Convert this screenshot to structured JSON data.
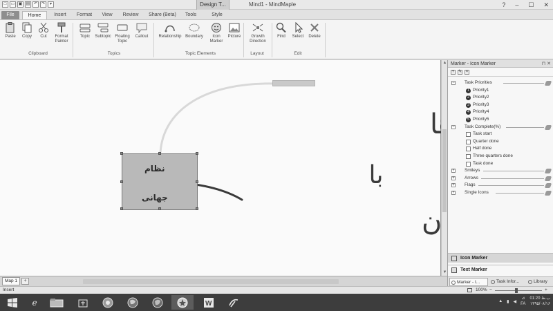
{
  "titlebar": {
    "context_tab": "Design T...",
    "title": "Mind1 - MindMaple",
    "help": "?",
    "minimize": "–",
    "maximize": "☐",
    "close": "✕"
  },
  "tabs": [
    "File",
    "Home",
    "Insert",
    "Format",
    "View",
    "Review",
    "Share (Beta)",
    "Tools",
    "Style"
  ],
  "ribbon": {
    "clipboard": {
      "paste": "Paste",
      "copy": "Copy",
      "cut": "Cut",
      "format_painter": "Format Painter",
      "label": "Clipboard"
    },
    "topics": {
      "topic": "Topic",
      "subtopic": "Subtopic",
      "floating_topic": "Floating Topic",
      "callout": "Callout",
      "label": "Topics"
    },
    "elements": {
      "relationship": "Relationship",
      "boundary": "Boundary",
      "icon_marker": "Icon Marker",
      "picture": "Picture",
      "label": "Topic Elements"
    },
    "layout": {
      "growth": "Growth Direction",
      "label": "Layout"
    },
    "edit": {
      "find": "Find",
      "select": "Select",
      "delete": "Delete",
      "label": "Edit"
    }
  },
  "canvas": {
    "topic_line1": "نظام",
    "topic_line2": "جهانی",
    "handwriting": {
      "line1": "رسم ارتباط ها",
      "line2": "با",
      "line3": "کشیدن از مرکز عنوان"
    }
  },
  "map_tab": "Map 1",
  "panel": {
    "title": "Marker - Icon Marker",
    "pin": "⊓",
    "close": "✕",
    "tree": [
      {
        "type": "group",
        "label": "Task Priorities",
        "expanded": true
      },
      {
        "type": "priority",
        "label": "Priority1",
        "num": "1"
      },
      {
        "type": "priority",
        "label": "Priority2",
        "num": "2"
      },
      {
        "type": "priority",
        "label": "Priority3",
        "num": "3"
      },
      {
        "type": "priority",
        "label": "Priority4",
        "num": "4"
      },
      {
        "type": "priority",
        "label": "Priority5",
        "num": "5"
      },
      {
        "type": "group",
        "label": "Task Complete(%)",
        "expanded": true
      },
      {
        "type": "task",
        "label": "Task start"
      },
      {
        "type": "task",
        "label": "Quarter done"
      },
      {
        "type": "task",
        "label": "Half done"
      },
      {
        "type": "task",
        "label": "Three quarters done"
      },
      {
        "type": "task",
        "label": "Task done"
      },
      {
        "type": "group",
        "label": "Smileys",
        "expanded": false
      },
      {
        "type": "group",
        "label": "Arrows",
        "expanded": false
      },
      {
        "type": "group",
        "label": "Flags",
        "expanded": false
      },
      {
        "type": "group",
        "label": "Single Icons",
        "expanded": false
      }
    ],
    "icon_marker_btn": "Icon Marker",
    "text_marker_btn": "Text Marker",
    "bottom_tabs": [
      "Marker - I...",
      "Task Infor...",
      "Library"
    ]
  },
  "status": {
    "mode": "Insert",
    "zoom": "100%"
  },
  "taskbar": {
    "clock_time": "01:20 ب.ظ",
    "clock_date": "۱۳۹۵/۰۸/۱۶",
    "lang_top": "⊿",
    "lang": "FA"
  }
}
